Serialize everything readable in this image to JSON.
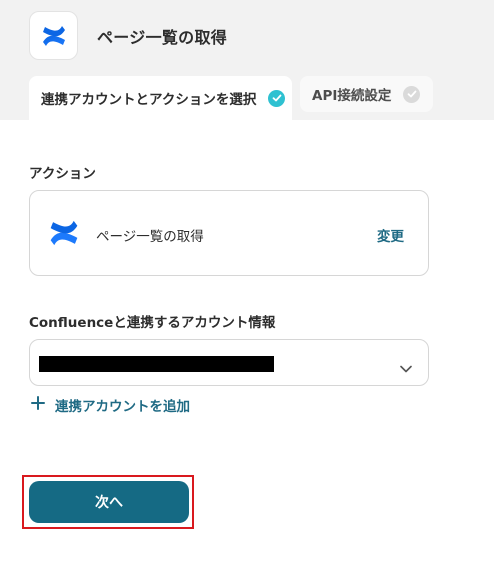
{
  "header": {
    "app_icon": "confluence-logo",
    "title": "ページ一覧の取得"
  },
  "tabs": [
    {
      "label": "連携アカウントとアクションを選択",
      "completed": true,
      "active": true
    },
    {
      "label": "API接続設定",
      "completed": false,
      "active": false
    }
  ],
  "action_section": {
    "label": "アクション",
    "action_name": "ページ一覧の取得",
    "change_label": "変更"
  },
  "account_section": {
    "label": "Confluenceと連携するアカウント情報",
    "selected_value_redacted": true,
    "add_account_label": "連携アカウントを追加"
  },
  "footer": {
    "next_label": "次へ"
  },
  "colors": {
    "accent": "#156a84",
    "link": "#1f6a84",
    "check_active": "#2fc1d1",
    "highlight": "#d9191e"
  }
}
